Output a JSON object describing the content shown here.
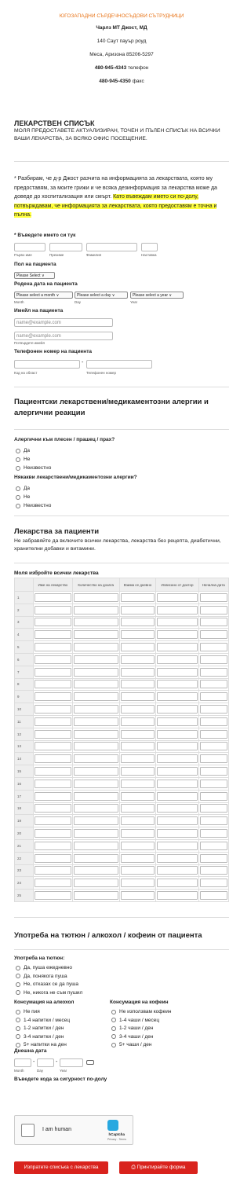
{
  "header": {
    "org": "ЮГОЗАПАДНИ СЪРДЕЧНОСЪДОВИ СЪТРУДНИЦИ",
    "doctor": "Чарлз МТ Джост, МД",
    "address1": "140 Саут пауър роуд",
    "address2": "Меса, Аризона 85206-5297",
    "phone": "480-945-4343",
    "phone_label": " телефон",
    "fax": "480-945-4350",
    "fax_label": " факс"
  },
  "intro": {
    "title": "ЛЕКАРСТВЕН СПИСЪК",
    "subtitle": "МОЛЯ ПРЕДОСТАВЕТЕ АКТУАЛИЗИРАН, ТОЧЕН И ПЪЛЕН СПИСЪК НА ВСИЧКИ ВАШИ ЛЕКАРСТВА, ЗА ВСЯКО ОФИС ПОСЕЩЕНИЕ.",
    "agree_text": "* Разбирам, че д-р Джост разчита на информацията за лекарствата, която му предоставям, за моите грижи и че всяка дезинформация за лекарства може да доведе до хоспитализация или смърт. ",
    "agree_highlight": "Като въвеждам името си по-долу, потвърждавам, че информацията за лекарствата, която предоставям е точна и пълна."
  },
  "form": {
    "name_label": "* Въведете името си тук",
    "name_sub": [
      "Първо име",
      "Презиме",
      "Фамилия",
      "Наставка"
    ],
    "gender_label": "Пол на пациента",
    "gender_value": "Please Select ∨",
    "dob_label": "Родена дата на пациента",
    "dob_month": "Please select a month ∨",
    "dob_day": "Please select a day ∨",
    "dob_year": "Please select a year ∨",
    "dob_sub": [
      "Month",
      "Day",
      "Year"
    ],
    "email_label": "Имейл на пациента",
    "email_placeholder": "name@example.com",
    "email_confirm_placeholder": "name@example.com",
    "email_confirm_sub": "Потвърдете имейл",
    "phone_label": "Телефонен номер на пациента",
    "phone_sub": [
      "Код на област",
      "Телефонен номер"
    ]
  },
  "allergy": {
    "title": "Пациентски лекарствени/медикаментозни алергии и алергични реакции",
    "q1": "Алергични към плесен / прашец / прах?",
    "q2": "Някакви лекарствени/медикаментозни алергии?",
    "options": [
      "Да",
      "Не",
      "Неизвестно"
    ]
  },
  "meds": {
    "title": "Лекарства за пациенти",
    "note": "Не забравяйте да включите всички лекарства, лекарства без рецепта, диабетични, хранителни добавки и витамини.",
    "list_label": "Моля избройте всички лекарства",
    "columns": [
      "Име на лекарство",
      "Количество на дозата",
      "Взима се дневно",
      "Изписано от доктор",
      "Начална дата"
    ],
    "rows": [
      "1",
      "2",
      "3",
      "4",
      "5",
      "6",
      "7",
      "8",
      "9",
      "10",
      "11",
      "12",
      "13",
      "14",
      "15",
      "16",
      "17",
      "18",
      "19",
      "20",
      "21",
      "22",
      "23",
      "24",
      "25"
    ]
  },
  "habits": {
    "title": "Употреба на тютюн / алкохол / кофеин от пациента",
    "tobacco_label": "Употреба на тютюн:",
    "tobacco": [
      "Да, пуша ежедневно",
      "Да, понякога пуша",
      "Не, отказах се да пуша",
      "Не, никога не съм пушил"
    ],
    "alcohol_label": "Консумация на алкохол",
    "alcohol": [
      "Не пия",
      "1-4 напитки / месец",
      "1-2 напитки / ден",
      "3-4 напитки / ден",
      "5+ напитки на ден"
    ],
    "caffeine_label": "Консумация на кофеин",
    "caffeine": [
      "Не използвам кофеин",
      "1-4 чаши / месец",
      "1-2 чаши / ден",
      "3-4 чаши / ден",
      "5+ чаши / ден"
    ],
    "date_label": "Днешна дата",
    "date_sub": [
      "Month",
      "Day",
      "Year"
    ],
    "captcha_label": "Въведете кода за сигурност по-долу",
    "captcha_text": "I am human",
    "captcha_brand": "hCaptcha",
    "captcha_links": "Privacy - Terms",
    "submit": "Изпратете списъка с лекарства",
    "print": "Принтирайте форма"
  },
  "colors": {
    "accent": "#e8751a",
    "button": "#d9231d",
    "highlight": "#ffff3c"
  }
}
